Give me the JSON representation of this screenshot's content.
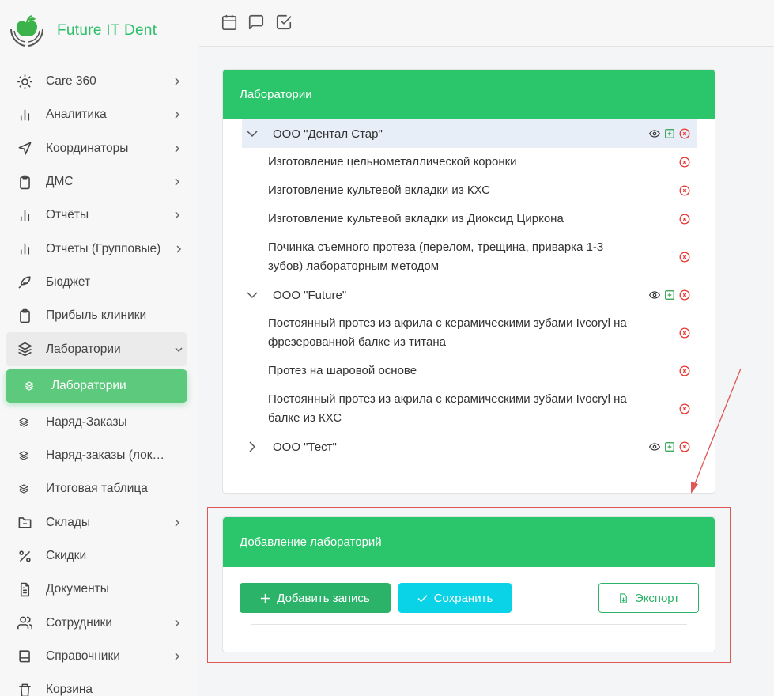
{
  "app": {
    "brand": "Future IT Dent"
  },
  "sidebar": {
    "items": [
      {
        "label": "Care 360",
        "icon": "sun-icon",
        "chevron": true
      },
      {
        "label": "Аналитика",
        "icon": "bar-chart-icon",
        "chevron": true
      },
      {
        "label": "Координаторы",
        "icon": "send-icon",
        "chevron": true
      },
      {
        "label": "ДМС",
        "icon": "clipboard-icon",
        "chevron": true
      },
      {
        "label": "Отчёты",
        "icon": "bar-chart-icon",
        "chevron": true
      },
      {
        "label": "Отчеты (Групповые)",
        "icon": "bar-chart-icon",
        "chevron": true
      },
      {
        "label": "Бюджет",
        "icon": "feather-icon",
        "chevron": false
      },
      {
        "label": "Прибыль клиники",
        "icon": "clipboard-icon",
        "chevron": false
      },
      {
        "label": "Лаборатории",
        "icon": "layers-icon",
        "chevron": true,
        "open": true
      },
      {
        "label": "Лаборатории",
        "icon": "layers-icon",
        "sub": true,
        "active": true
      },
      {
        "label": "Наряд-Заказы",
        "icon": "layers-icon",
        "sub": true
      },
      {
        "label": "Наряд-заказы (лок…",
        "icon": "layers-icon",
        "sub": true
      },
      {
        "label": "Итоговая таблица",
        "icon": "layers-icon",
        "sub": true
      },
      {
        "label": "Склады",
        "icon": "folder-minus-icon",
        "chevron": true
      },
      {
        "label": "Скидки",
        "icon": "percent-icon",
        "chevron": false
      },
      {
        "label": "Документы",
        "icon": "file-text-icon",
        "chevron": false
      },
      {
        "label": "Сотрудники",
        "icon": "users-icon",
        "chevron": true
      },
      {
        "label": "Справочники",
        "icon": "book-icon",
        "chevron": true
      },
      {
        "label": "Корзина",
        "icon": "trash-icon",
        "chevron": false
      }
    ]
  },
  "topbar": {
    "icons": [
      "calendar-icon",
      "message-square-icon",
      "check-square-icon"
    ]
  },
  "labs_card": {
    "title": "Лаборатории",
    "tree": [
      {
        "name": "ООО \"Дентал Стар\"",
        "expanded": true,
        "selected": true,
        "children": [
          "Изготовление цельнометаллической коронки",
          "Изготовление культевой вкладки из КХС",
          "Изготовление культевой вкладки из Диоксид Циркона",
          "Починка съемного протеза (перелом, трещина, приварка 1-3 зубов) лабораторным методом"
        ]
      },
      {
        "name": "ООО \"Future\"",
        "expanded": true,
        "selected": false,
        "children": [
          "Постоянный протез из акрила с керамическими зубами Ivcoryl на фрезерованной балке из титана",
          "Протез на шаровой основе",
          "Постоянный протез из акрила с керамическими зубами Ivocryl на балке из КХС"
        ]
      },
      {
        "name": "ООО \"Тест\"",
        "expanded": false,
        "selected": false,
        "children": []
      }
    ]
  },
  "add_card": {
    "title": "Добавление лабораторий",
    "add_label": "Добавить запись",
    "save_label": "Сохранить",
    "export_label": "Экспорт"
  },
  "colors": {
    "accent": "#2bc66c",
    "save": "#0bd3e7",
    "delete": "#e53935",
    "annotation": "#e05555"
  }
}
